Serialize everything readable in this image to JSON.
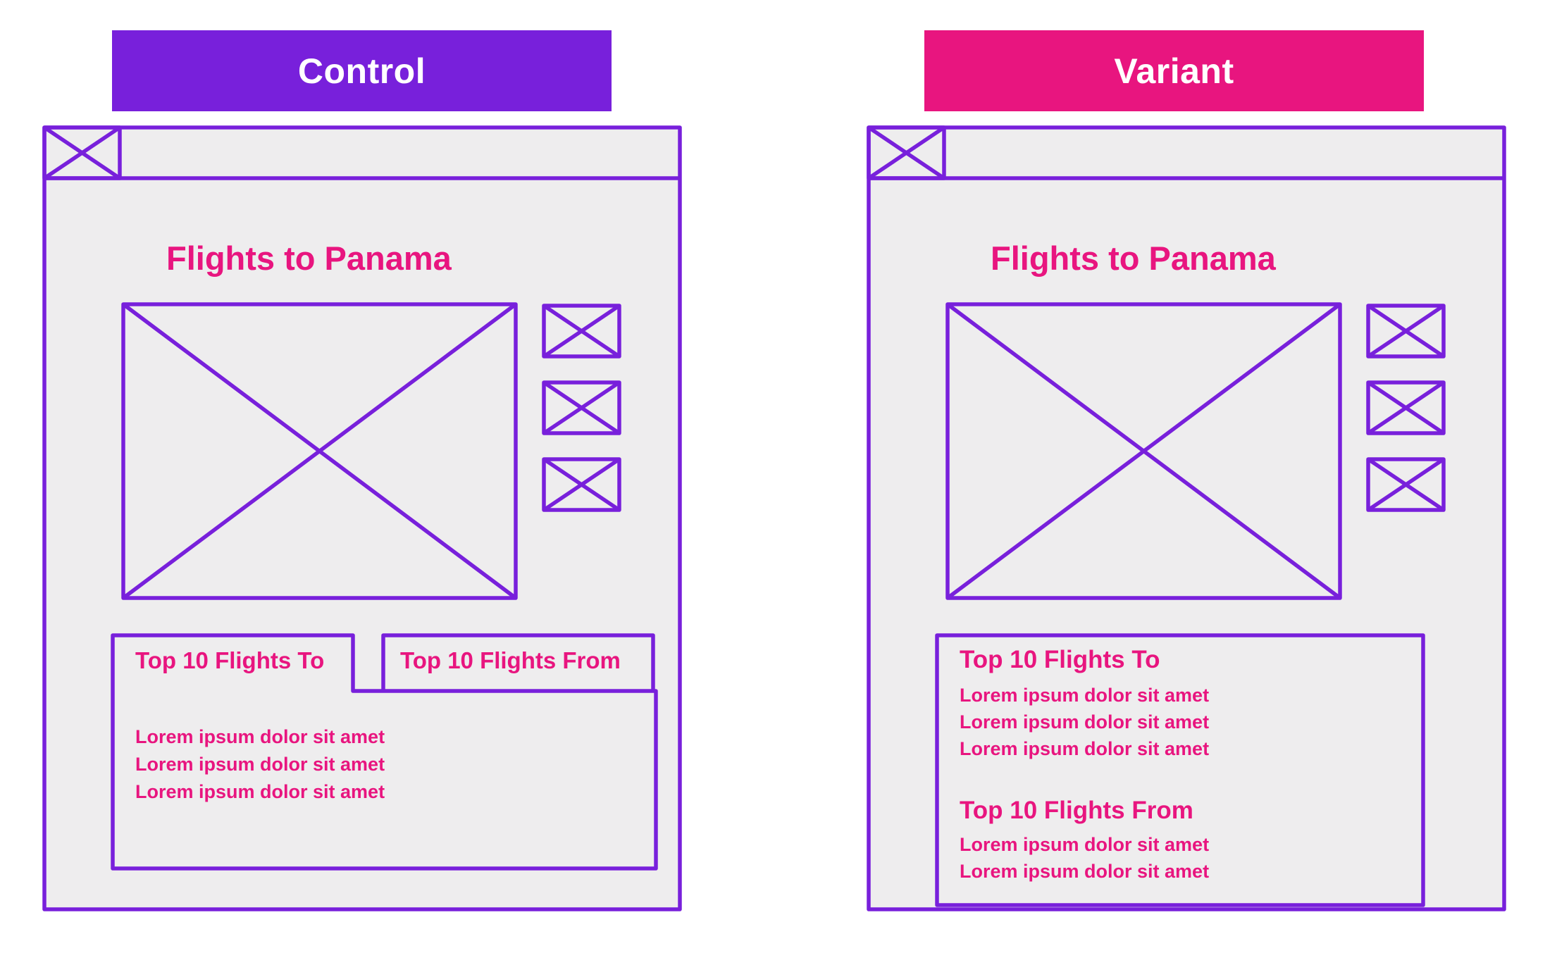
{
  "colors": {
    "control_accent": "#7820DB",
    "variant_accent": "#E8157F",
    "wireframe_stroke": "#7820DB",
    "wireframe_fill": "#EEEDEE",
    "text_accent": "#E8157F",
    "banner_text": "#FFFFFF"
  },
  "control": {
    "banner_label": "Control",
    "page_heading": "Flights to Panama",
    "icons": [
      "logo-placeholder-icon",
      "hero-image-placeholder-icon",
      "thumbnail-placeholder-icon",
      "thumbnail-placeholder-icon",
      "thumbnail-placeholder-icon"
    ],
    "tabs": [
      {
        "label": "Top 10 Flights To",
        "active": true
      },
      {
        "label": "Top 10 Flights From",
        "active": false
      }
    ],
    "tab_content": [
      "Lorem ipsum dolor sit amet",
      "Lorem ipsum dolor sit amet",
      "Lorem ipsum dolor sit amet"
    ]
  },
  "variant": {
    "banner_label": "Variant",
    "page_heading": "Flights to Panama",
    "icons": [
      "logo-placeholder-icon",
      "hero-image-placeholder-icon",
      "thumbnail-placeholder-icon",
      "thumbnail-placeholder-icon",
      "thumbnail-placeholder-icon"
    ],
    "sections": [
      {
        "title": "Top 10 Flights To",
        "items": [
          "Lorem ipsum dolor sit amet",
          "Lorem ipsum dolor sit amet",
          "Lorem ipsum dolor sit amet"
        ]
      },
      {
        "title": "Top 10 Flights From",
        "items": [
          "Lorem ipsum dolor sit amet",
          "Lorem ipsum dolor sit amet"
        ]
      }
    ]
  }
}
